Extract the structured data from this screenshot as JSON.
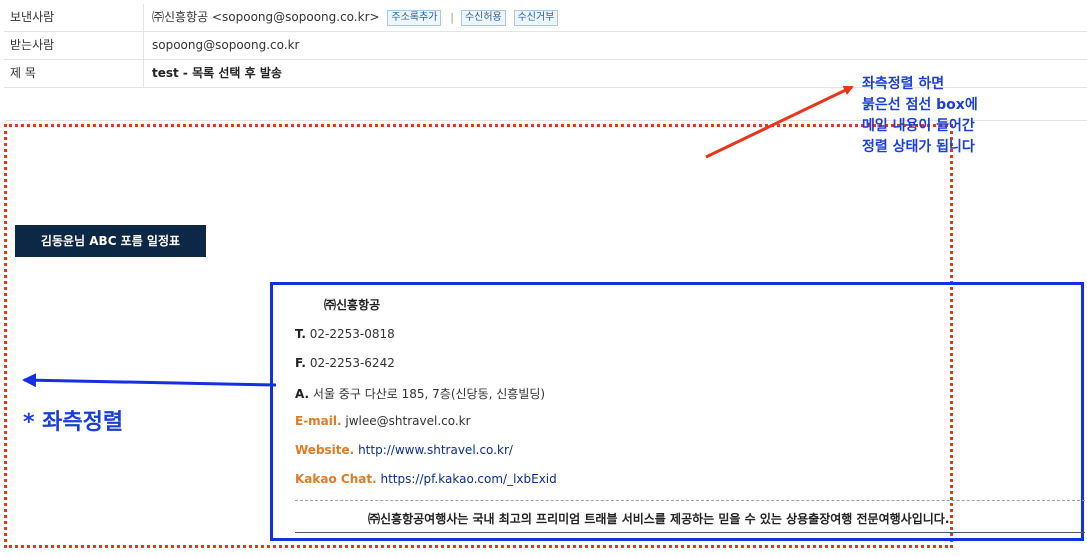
{
  "header": {
    "sender_label": "보낸사람",
    "sender_value": "㈜신흥항공 <sopoong@sopoong.co.kr>",
    "btn_add_address": "주소록추가",
    "btn_allow": "수신허용",
    "btn_block": "수신거부",
    "recipient_label": "받는사람",
    "recipient_value": "sopoong@sopoong.co.kr",
    "subject_label": "제 목",
    "subject_value": "test - 목록 선택 후 발송"
  },
  "annotations": {
    "top_note": [
      "좌측정렬 하면",
      "붉은선 점선 box에",
      "메일 내용이 들어간",
      "정렬 상태가 됩니다"
    ],
    "left_note": "* 좌측정렬",
    "red_color": "#e8361b",
    "blue_color": "#1530e0"
  },
  "body": {
    "title_pill": "김동윤님 ABC 포름 일정표",
    "title_pill_color": "#0d2846"
  },
  "signature": {
    "company": "㈜신흥항공",
    "tel_key": "T.",
    "tel_value": "02-2253-0818",
    "fax_key": "F.",
    "fax_value": "02-2253-6242",
    "addr_key": "A.",
    "addr_value": "서울 중구 다산로 185, 7층(신당동, 신흥빌딩)",
    "email_key": "E-mail.",
    "email_value": "jwlee@shtravel.co.kr",
    "website_key": "Website.",
    "website_value": "http://www.shtravel.co.kr/",
    "kakao_key": "Kakao Chat.",
    "kakao_value": "https://pf.kakao.com/_lxbExid",
    "footer": "㈜신흥항공여행사는 국내 최고의 프리미엄 트래블 서비스를 제공하는 믿을 수 있는 상용출장여행 전문여행사입니다.",
    "accent_orange": "#e07b24"
  }
}
